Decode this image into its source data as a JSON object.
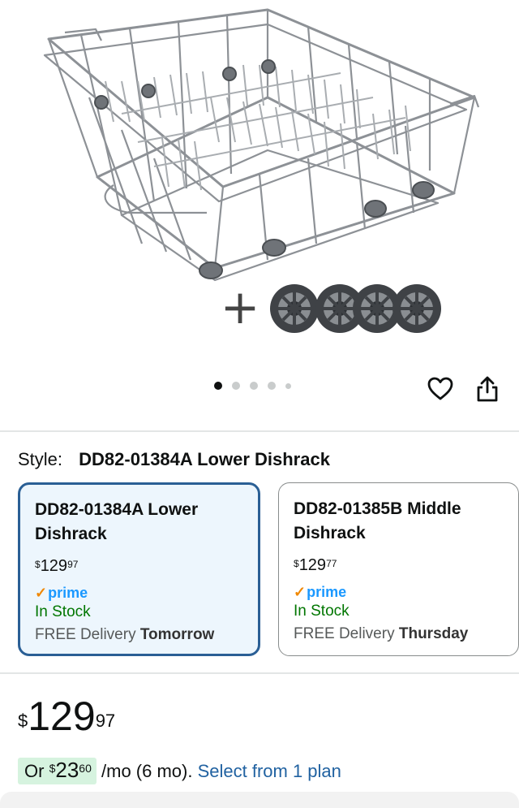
{
  "product_image": {
    "alt": "DD82-01384A Lower Dishrack with 4 replacement wheels",
    "plus_symbol": "+"
  },
  "carousel": {
    "count": 5,
    "active_index": 0
  },
  "actions": {
    "favorite_icon": "heart-icon",
    "share_icon": "share-icon"
  },
  "style": {
    "label": "Style:",
    "value": "DD82-01384A Lower Dishrack",
    "options": [
      {
        "name": "DD82-01384A Lower Dishrack",
        "price_symbol": "$",
        "price_whole": "129",
        "price_fraction": "97",
        "prime": "prime",
        "stock": "In Stock",
        "delivery_prefix": "FREE Delivery",
        "delivery_day": "Tomorrow",
        "selected": true
      },
      {
        "name": "DD82-01385B Middle Dishrack",
        "price_symbol": "$",
        "price_whole": "129",
        "price_fraction": "77",
        "prime": "prime",
        "stock": "In Stock",
        "delivery_prefix": "FREE Delivery",
        "delivery_day": "Thursday",
        "selected": false
      }
    ]
  },
  "price": {
    "symbol": "$",
    "whole": "129",
    "fraction": "97"
  },
  "installment": {
    "prefix": "Or",
    "symbol": "$",
    "whole": "23",
    "fraction": "60",
    "suffix": "/mo (6 mo).",
    "link": "Select from 1 plan"
  },
  "colors": {
    "selected_border": "#2a5f95",
    "selected_bg": "#edf6fd",
    "prime_blue": "#1a98ff",
    "stock_green": "#007600",
    "link_blue": "#2162a1",
    "installment_bg": "#d6f3df"
  }
}
